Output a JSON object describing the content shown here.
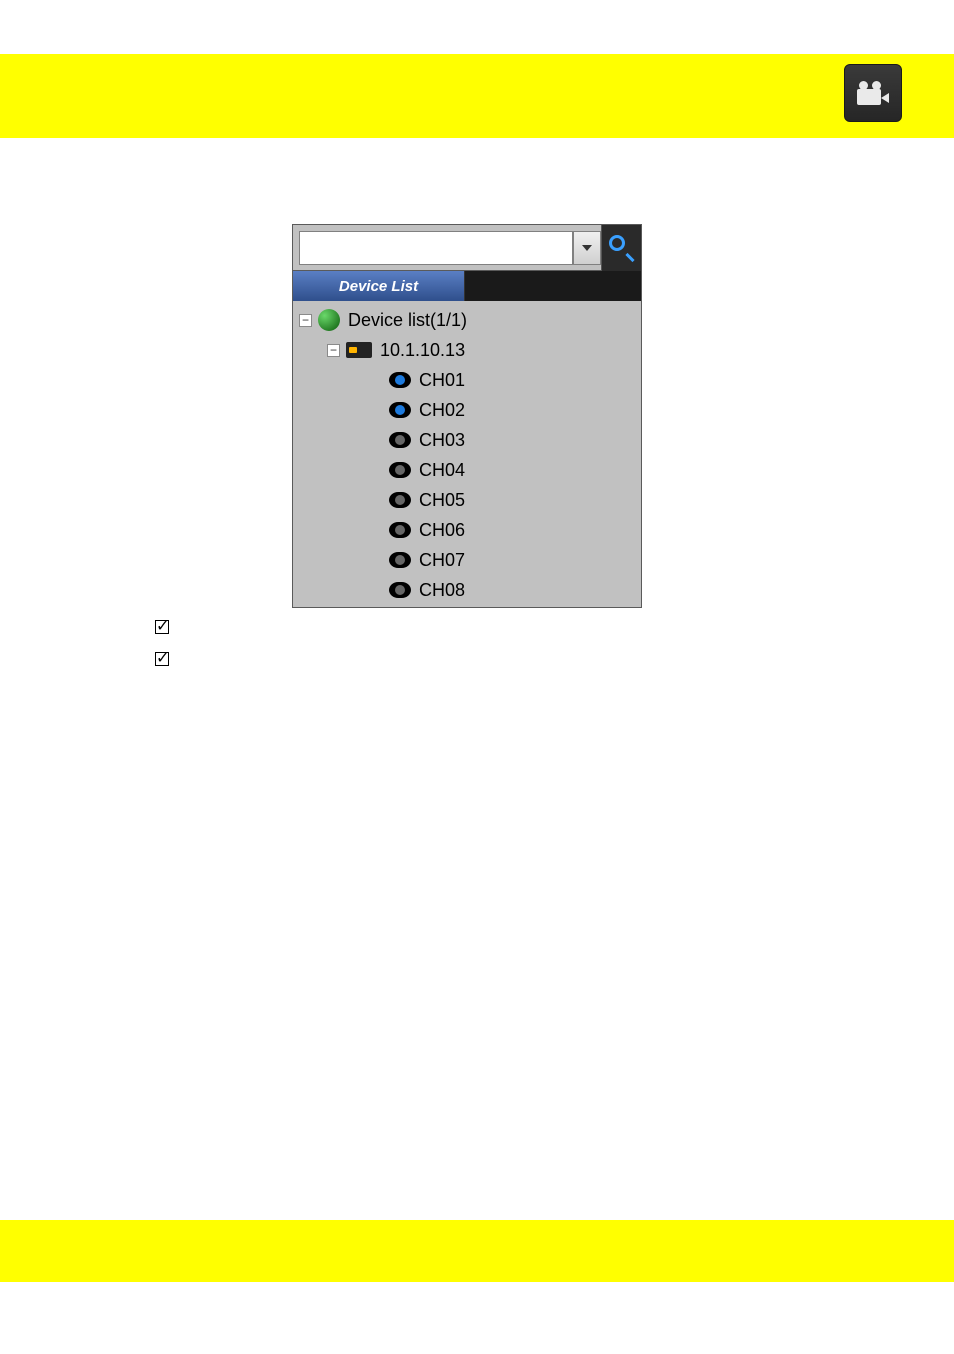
{
  "panel": {
    "search": {
      "value": "",
      "placeholder": ""
    },
    "tab_label": "Device List",
    "root_label": "Device list(1/1)",
    "device_ip": "10.1.10.13",
    "channels": [
      {
        "label": "CH01",
        "active": true
      },
      {
        "label": "CH02",
        "active": true
      },
      {
        "label": "CH03",
        "active": false
      },
      {
        "label": "CH04",
        "active": false
      },
      {
        "label": "CH05",
        "active": false
      },
      {
        "label": "CH06",
        "active": false
      },
      {
        "label": "CH07",
        "active": false
      },
      {
        "label": "CH08",
        "active": false
      }
    ]
  },
  "links": {
    "line1_prefix": "",
    "line1_link": "",
    "line2_prefix": "",
    "line2_link": ""
  }
}
